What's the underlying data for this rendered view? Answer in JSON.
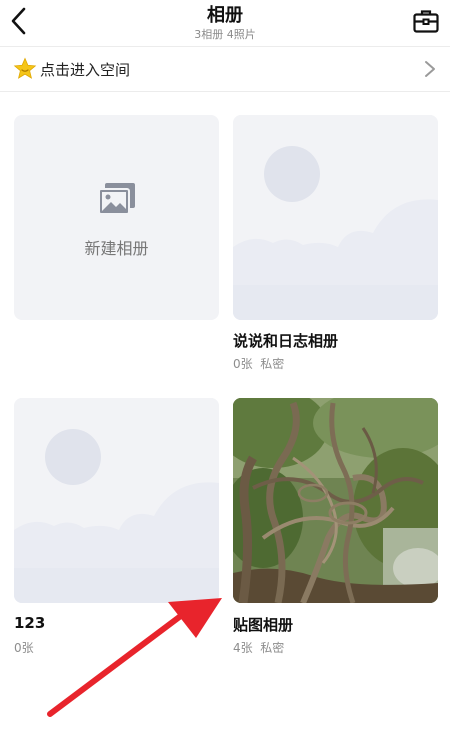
{
  "header": {
    "title": "相册",
    "subtitle": "3相册  4照片",
    "back_icon": "chevron-left-icon",
    "tools_icon": "toolbox-icon"
  },
  "banner": {
    "label": "点击进入空间",
    "icon": "star-badge-icon",
    "icon_color": "#f5c518",
    "chevron_icon": "chevron-right-icon"
  },
  "new_album": {
    "label": "新建相册",
    "icon": "gallery-icon"
  },
  "albums": [
    {
      "name": "说说和日志相册",
      "count": "0张",
      "privacy": "私密",
      "cover": "placeholder"
    },
    {
      "name": "123",
      "count": "0张",
      "privacy": "",
      "cover": "placeholder"
    },
    {
      "name": "贴图相册",
      "count": "4张",
      "privacy": "私密",
      "cover": "tree-vines-photo"
    }
  ],
  "annotation": {
    "type": "red-arrow",
    "color": "#e8242c"
  }
}
